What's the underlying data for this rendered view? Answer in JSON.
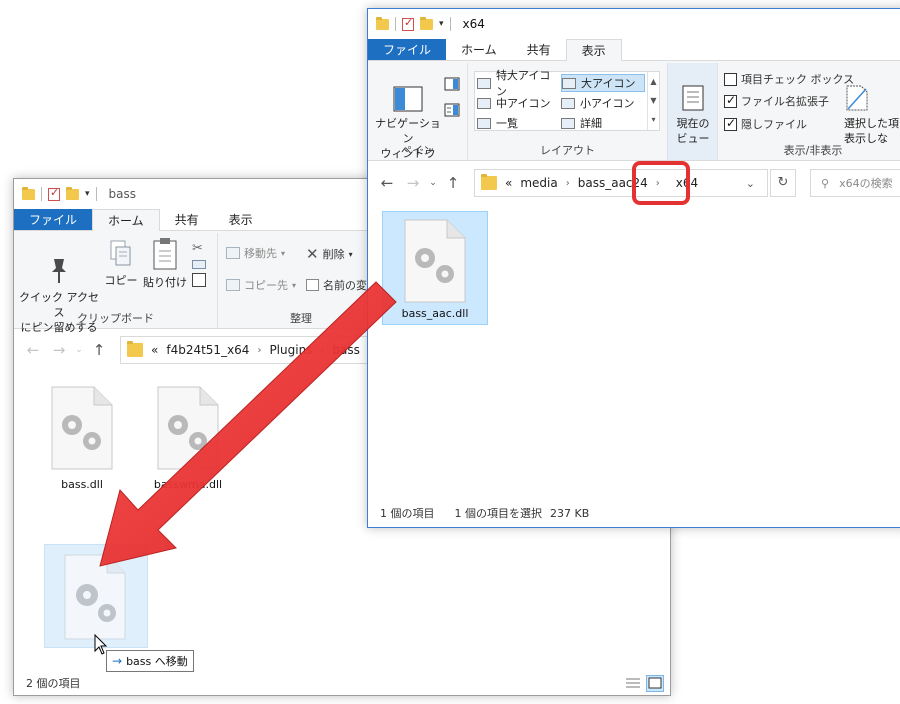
{
  "windowA": {
    "title": "bass",
    "tabs": [
      "ファイル",
      "ホーム",
      "共有",
      "表示"
    ],
    "clipboard": {
      "pin_label": "クイック アクセス\nにピン留めする",
      "copy_label": "コピー",
      "paste_label": "貼り付け",
      "group_label": "クリップボード"
    },
    "organize": {
      "move_label": "移動先",
      "copy_to_label": "コピー先",
      "delete_label": "削除",
      "rename_label": "名前の変",
      "group_label": "整理"
    },
    "address": {
      "overflow": "«",
      "crumbs": [
        "f4b24t51_x64",
        "Plugins",
        "bass"
      ]
    },
    "files": [
      "bass.dll",
      "basswma.dll"
    ],
    "status": "2 個の項目"
  },
  "windowB": {
    "title": "x64",
    "tabs": [
      "ファイル",
      "ホーム",
      "共有",
      "表示"
    ],
    "pane": {
      "nav_label": "ナビゲーション\nウィンドウ",
      "group_label": "ペイン"
    },
    "layout": {
      "items": [
        "特大アイコン",
        "大アイコン",
        "中アイコン",
        "小アイコン",
        "一覧",
        "詳細"
      ],
      "selected": "大アイコン",
      "group_label": "レイアウト"
    },
    "current_view": {
      "label": "現在の\nビュー"
    },
    "show_hide": {
      "item_checkbox": "項目チェック ボックス",
      "file_ext": "ファイル名拡張子",
      "hidden_files": "隠しファイル",
      "item_checkbox_checked": false,
      "file_ext_checked": true,
      "hidden_files_checked": true,
      "selected_hide_label": "選択した項\n表示しな",
      "group_label": "表示/非表示"
    },
    "address": {
      "overflow": "«",
      "crumbs": [
        "media",
        "bass_aac24",
        "x64"
      ]
    },
    "search_placeholder": "x64の検索",
    "files": [
      "bass_aac.dll"
    ],
    "status": {
      "count": "1 個の項目",
      "selected": "1 個の項目を選択",
      "size": "237 KB"
    }
  },
  "drag": {
    "tooltip_text": "bass へ移動"
  },
  "colors": {
    "file_tab": "#1d6fc2",
    "arrow": "#e02b2b",
    "highlight": "#e43232",
    "selection": "#cce8ff"
  }
}
